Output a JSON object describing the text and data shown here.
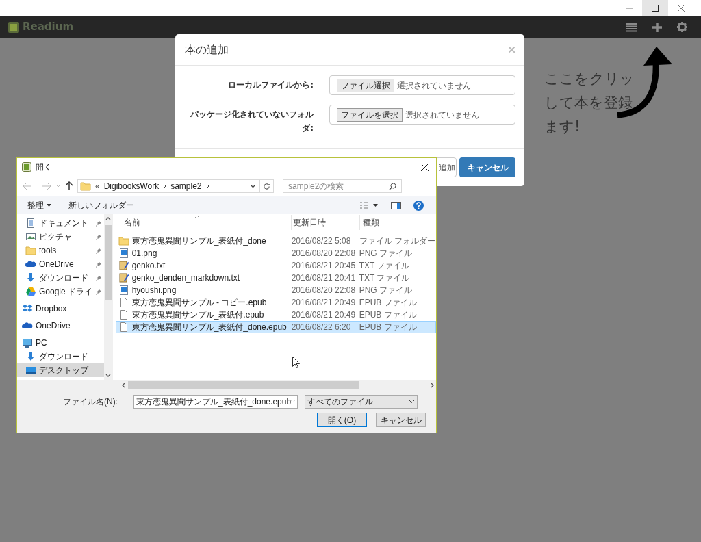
{
  "app": {
    "name": "Readium"
  },
  "modal": {
    "title": "本の追加",
    "fields": [
      {
        "label": "ローカルファイルから:",
        "button": "ファイル選択",
        "status": "選択されていません"
      },
      {
        "label": "パッケージ化されていないフォルダ:",
        "button": "ファイルを選択",
        "status": "選択されていません"
      }
    ],
    "buttons": [
      {
        "label": "追加",
        "kind": "default"
      },
      {
        "label": "キャンセル",
        "kind": "primary"
      }
    ]
  },
  "annotation": {
    "lines": [
      "ここをクリッ",
      "して本を登録",
      "ます!"
    ]
  },
  "file_dialog": {
    "title": "開く",
    "path_prefix": "«",
    "path": [
      "DigibooksWork",
      "sample2"
    ],
    "search": {
      "placeholder": "sample2の検索"
    },
    "toolbar": [
      {
        "label": "整理",
        "kind": "menu"
      },
      {
        "label": "新しいフォルダー",
        "kind": "button"
      }
    ],
    "nav": {
      "quick_access": [
        {
          "label": "ドキュメント",
          "kind": "document",
          "pinned": true,
          "selected": false
        },
        {
          "label": "ピクチャ",
          "kind": "picture",
          "pinned": true,
          "selected": false
        },
        {
          "label": "tools",
          "kind": "folder",
          "pinned": true,
          "selected": false
        },
        {
          "label": "OneDrive",
          "kind": "cloud",
          "pinned": true,
          "selected": false
        },
        {
          "label": "ダウンロード",
          "kind": "download",
          "pinned": true,
          "selected": false
        },
        {
          "label": "Google ドライ",
          "kind": "drive",
          "pinned": true,
          "selected": false
        }
      ],
      "places": [
        {
          "label": "Dropbox",
          "kind": "dropbox",
          "selected": false
        },
        {
          "label": "OneDrive",
          "kind": "cloud",
          "selected": false
        },
        {
          "label": "PC",
          "kind": "pc",
          "selected": false,
          "children": [
            {
              "label": "ダウンロード",
              "kind": "download",
              "selected": false
            },
            {
              "label": "デスクトップ",
              "kind": "desktop",
              "selected": true
            }
          ]
        }
      ]
    },
    "columns": [
      "名前",
      "更新日時",
      "種類"
    ],
    "files": [
      {
        "name": "東方恋鬼異聞サンプル_表紙付_done",
        "date": "2016/08/22 5:08",
        "type": "ファイル フォルダー",
        "kind": "folder",
        "selected": false
      },
      {
        "name": "01.png",
        "date": "2016/08/20 22:08",
        "type": "PNG ファイル",
        "kind": "image",
        "selected": false
      },
      {
        "name": "genko.txt",
        "date": "2016/08/21 20:45",
        "type": "TXT ファイル",
        "kind": "text",
        "selected": false
      },
      {
        "name": "genko_denden_markdown.txt",
        "date": "2016/08/21 20:41",
        "type": "TXT ファイル",
        "kind": "text",
        "selected": false
      },
      {
        "name": "hyoushi.png",
        "date": "2016/08/20 22:08",
        "type": "PNG ファイル",
        "kind": "image",
        "selected": false
      },
      {
        "name": "東方恋鬼異聞サンプル - コピー.epub",
        "date": "2016/08/21 20:49",
        "type": "EPUB ファイル",
        "kind": "file",
        "selected": false
      },
      {
        "name": "東方恋鬼異聞サンプル_表紙付.epub",
        "date": "2016/08/21 20:49",
        "type": "EPUB ファイル",
        "kind": "file",
        "selected": false
      },
      {
        "name": "東方恋鬼異聞サンプル_表紙付_done.epub",
        "date": "2016/08/22 6:20",
        "type": "EPUB ファイル",
        "kind": "file",
        "selected": true
      }
    ],
    "file_name": {
      "label": "ファイル名(N):",
      "value": "東方恋鬼異聞サンプル_表紙付_done.epub"
    },
    "filter": "すべてのファイル",
    "buttons": [
      {
        "label": "開く(O)",
        "kind": "default"
      },
      {
        "label": "キャンセル",
        "kind": "normal"
      }
    ]
  }
}
